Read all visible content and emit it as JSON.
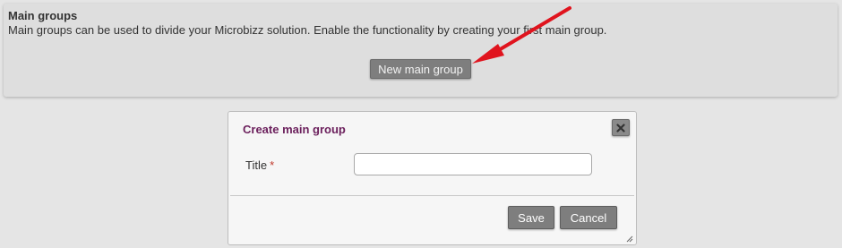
{
  "panel": {
    "title": "Main groups",
    "description": "Main groups can be used to divide your Microbizz solution. Enable the functionality by creating your first main group.",
    "new_button_label": "New main group"
  },
  "annotation": {
    "arrow_color": "#e0141e"
  },
  "dialog": {
    "title": "Create main group",
    "close_icon": "close-icon",
    "title_field": {
      "label": "Title",
      "required_mark": "*",
      "value": ""
    },
    "save_label": "Save",
    "cancel_label": "Cancel"
  },
  "colors": {
    "dialog_title": "#6b1f5c",
    "button_bg": "#7e7e7e",
    "required": "#c0392b"
  }
}
